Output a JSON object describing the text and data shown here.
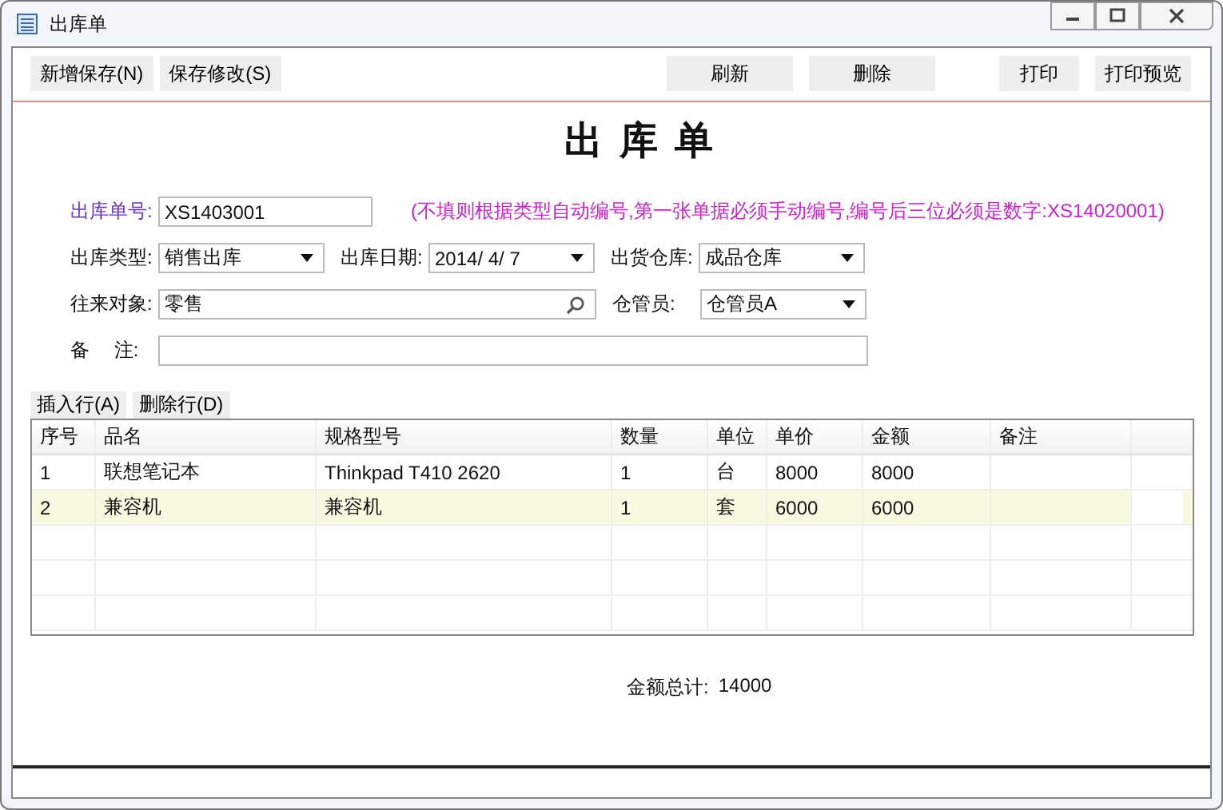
{
  "window": {
    "title": "出库单"
  },
  "toolbar": {
    "left": [
      {
        "label": "新增保存(N)"
      },
      {
        "label": "保存修改(S)"
      }
    ],
    "middle": [
      {
        "label": "刷新"
      },
      {
        "label": "删除"
      }
    ],
    "right": [
      {
        "label": "打印"
      },
      {
        "label": "打印预览"
      }
    ]
  },
  "form_title": "出 库 单",
  "form_rows": [
    [
      {
        "label": "出库单号:",
        "kind": "text",
        "value": "XS1403001",
        "highlight": true
      },
      {
        "kind": "hint",
        "text": "(不填则根据类型自动编号,第一张单据必须手动编号,编号后三位必须是数字:XS14020001)"
      }
    ],
    [
      {
        "label": "出库类型:",
        "kind": "select",
        "value": "销售出库"
      },
      {
        "label": "出库日期:",
        "kind": "select",
        "value": "2014/  4/  7"
      },
      {
        "label": "出货仓库:",
        "kind": "select",
        "value": "成品仓库"
      }
    ],
    [
      {
        "label": "往来对象:",
        "kind": "search",
        "value": "零售"
      },
      {
        "label": "仓管员:",
        "kind": "select",
        "value": "仓管员A"
      }
    ],
    [
      {
        "label": "备　 注:",
        "kind": "wide"
      }
    ]
  ],
  "grid_buttons": [
    {
      "label": "插入行(A)"
    },
    {
      "label": "删除行(D)"
    }
  ],
  "table": {
    "columns": [
      "序号",
      "品名",
      "规格型号",
      "数量",
      "单位",
      "单价",
      "金额",
      "备注"
    ],
    "rows": [
      {
        "cells": [
          "1",
          "联想笔记本",
          "Thinkpad T410 2620",
          "1",
          "台",
          "8000",
          "8000",
          ""
        ],
        "selected": false
      },
      {
        "cells": [
          "2",
          "兼容机",
          "兼容机",
          "1",
          "套",
          "6000",
          "6000",
          ""
        ],
        "selected": true
      }
    ]
  },
  "total": {
    "label": "金额总计:",
    "value": "14000"
  }
}
